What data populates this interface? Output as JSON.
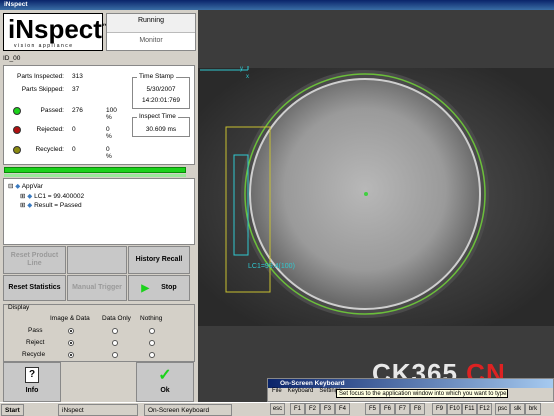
{
  "window": {
    "title": "iNspect"
  },
  "brand": {
    "logo": "iNspect",
    "tm": "™",
    "tagline": "vision appliance"
  },
  "status": {
    "running": "Running",
    "monitor": "Monitor"
  },
  "job": {
    "id": "ID_00"
  },
  "stats": {
    "parts_inspected_label": "Parts Inspected:",
    "parts_inspected": "313",
    "parts_skipped_label": "Parts Skipped:",
    "parts_skipped": "37",
    "passed_label": "Passed:",
    "passed": "276",
    "passed_pct": "100 %",
    "rejected_label": "Rejected:",
    "rejected": "0",
    "rejected_pct": "0 %",
    "recycled_label": "Recycled:",
    "recycled": "0",
    "recycled_pct": "0 %"
  },
  "timestamp": {
    "title": "Time Stamp",
    "date": "5/30/2007",
    "time": "14:20:01:769"
  },
  "inspect_time": {
    "title": "Inspect Time",
    "value": "30.609 ms"
  },
  "tree": {
    "root": "AppVar",
    "item1": "LC1 = 99.400002",
    "item2": "Result = Passed"
  },
  "buttons": {
    "reset_product_line": "Reset Product Line",
    "history_recall": "History Recall",
    "reset_statistics": "Reset Statistics",
    "manual_trigger": "Manual Trigger",
    "stop": "Stop",
    "info": "Info",
    "ok": "Ok"
  },
  "display": {
    "title": "Display",
    "col1": "Image & Data",
    "col2": "Data Only",
    "col3": "Nothing",
    "rows": [
      "Pass",
      "Reject",
      "Recycle"
    ]
  },
  "camera": {
    "overlay_label": "LC1=99.4(100)",
    "axis_x": "x",
    "axis_y": "y"
  },
  "keyboard": {
    "title": "On-Screen Keyboard",
    "menu": [
      "File",
      "Keyboard",
      "Settings"
    ],
    "tooltip": "Set focus to the application window into which you want to type.",
    "keys": [
      "esc",
      "F1",
      "F2",
      "F3",
      "F4",
      "F5",
      "F6",
      "F7",
      "F8",
      "F9",
      "F10",
      "F11",
      "F12",
      "psc",
      "slk",
      "brk"
    ]
  },
  "taskbar": {
    "start": "Start",
    "task1": "iNspect",
    "task2": "On-Screen Keyboard"
  },
  "watermark": {
    "text1": "CK365",
    "dot": ".",
    "text2": "CN"
  },
  "colors": {
    "green": "#1bd21b",
    "red": "#b01010",
    "olive": "#8a8a10"
  }
}
